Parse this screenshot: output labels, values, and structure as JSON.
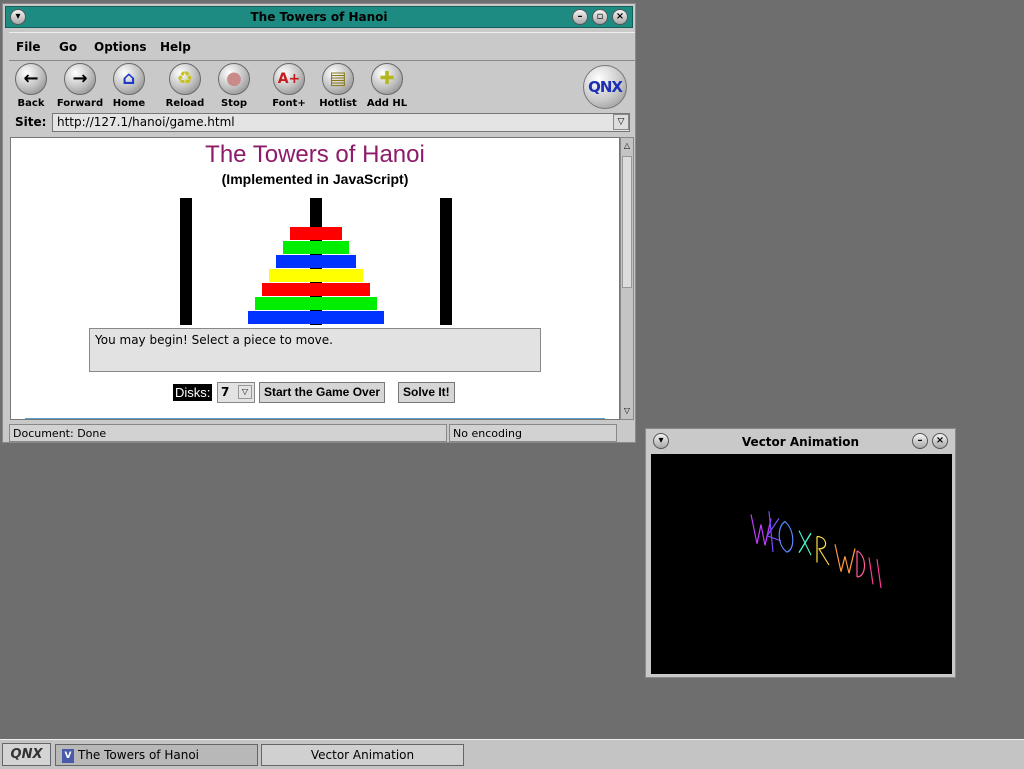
{
  "browser": {
    "title": "The Towers of Hanoi",
    "menu": [
      {
        "label": "File"
      },
      {
        "label": "Go"
      },
      {
        "label": "Options"
      },
      {
        "label": "Help"
      }
    ],
    "toolbar": [
      {
        "label": "Back",
        "icon": "left-arrow-icon"
      },
      {
        "label": "Forward",
        "icon": "right-arrow-icon"
      },
      {
        "label": "Home",
        "icon": "home-icon"
      },
      {
        "label": "Reload",
        "icon": "reload-icon"
      },
      {
        "label": "Stop",
        "icon": "stop-icon"
      },
      {
        "label": "Font+",
        "icon": "font-plus-icon"
      },
      {
        "label": "Hotlist",
        "icon": "hotlist-icon"
      },
      {
        "label": "Add HL",
        "icon": "add-hotlist-icon"
      }
    ],
    "logo": "QNX",
    "site_label": "Site:",
    "url": "http://127.1/hanoi/game.html",
    "status": "Document: Done",
    "encoding": "No encoding"
  },
  "page": {
    "title": "The Towers of Hanoi",
    "subtitle": "(Implemented in JavaScript)",
    "message": "You may begin! Select a piece to move.",
    "disks_label": "Disks:",
    "disks_value": "7",
    "start_button": "Start the Game Over",
    "solve_button": "Solve It!",
    "disk_colors": [
      "#ff0000",
      "#00ee00",
      "#0033ff",
      "#ffff00",
      "#ff0000",
      "#00ee00",
      "#0033ff"
    ]
  },
  "vector_window": {
    "title": "Vector Animation"
  },
  "taskbar": {
    "start": "QNX",
    "tasks": [
      {
        "label": "The Towers of Hanoi"
      },
      {
        "label": "Vector Animation"
      }
    ]
  }
}
